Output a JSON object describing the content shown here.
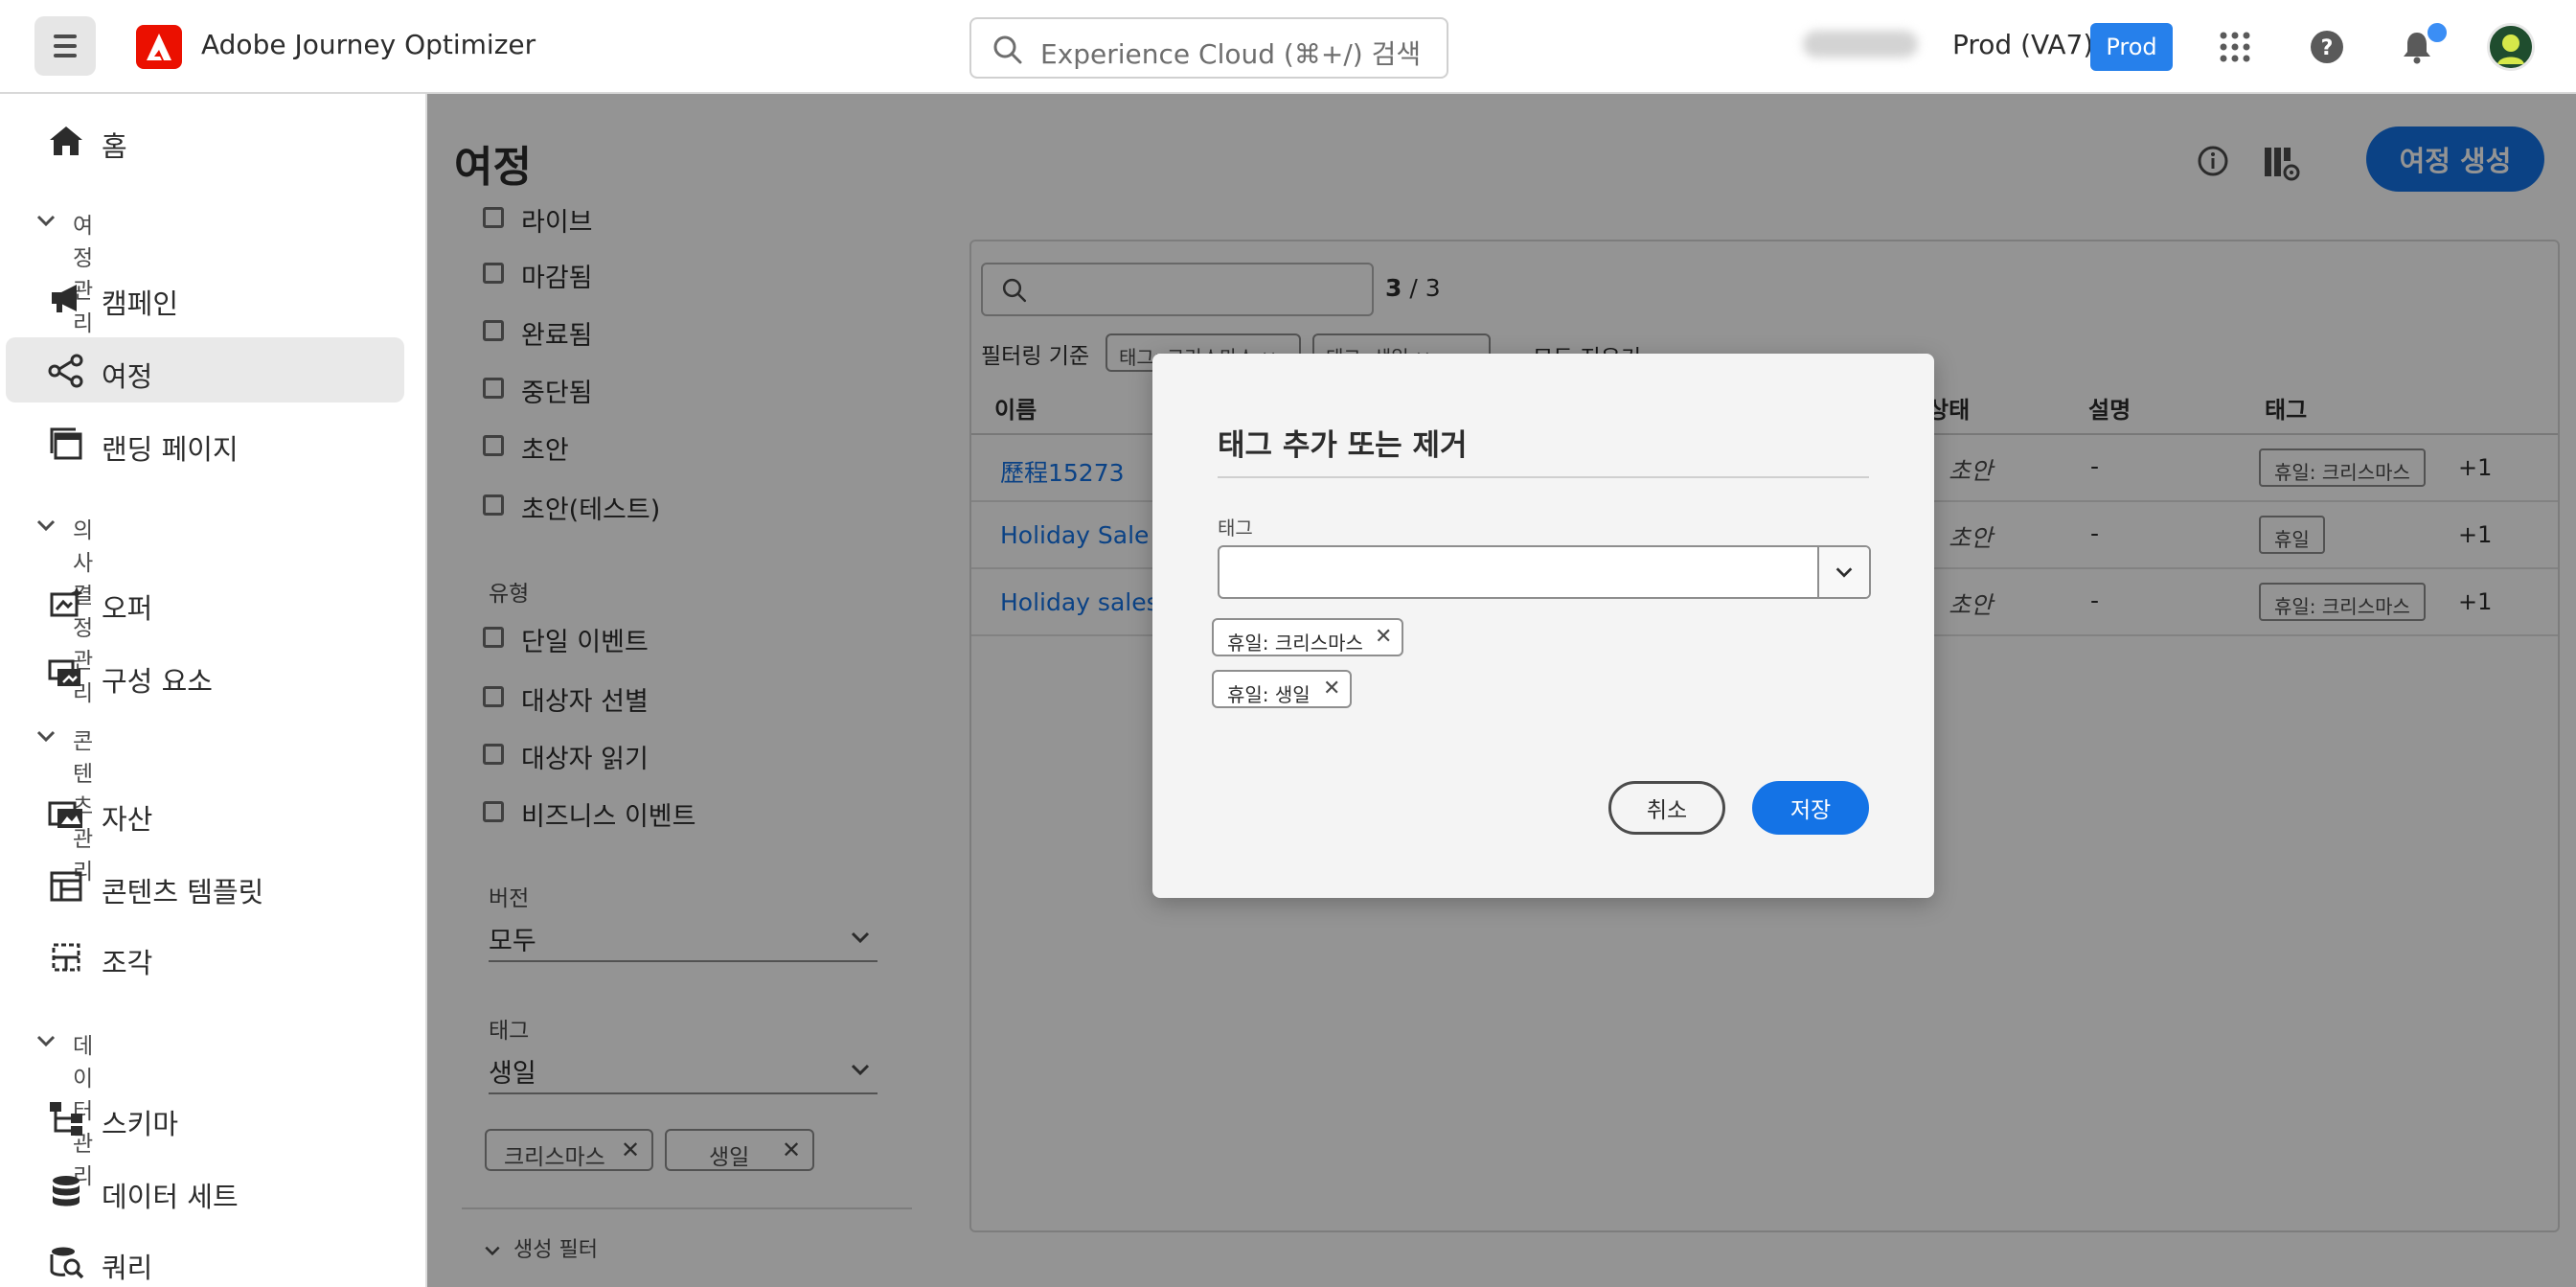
{
  "app": {
    "title": "Adobe Journey Optimizer",
    "search_placeholder": "Experience Cloud (⌘+/) 검색",
    "environment": "Prod (VA7)",
    "env_badge": "Prod"
  },
  "sidebar": {
    "home": "홈",
    "sections": [
      {
        "label": "여정 관리",
        "items": [
          "캠페인",
          "여정",
          "랜딩 페이지"
        ]
      },
      {
        "label": "의사 결정 관리",
        "items": [
          "오퍼",
          "구성 요소"
        ]
      },
      {
        "label": "콘텐츠 관리",
        "items": [
          "자산",
          "콘텐츠 템플릿",
          "조각"
        ]
      },
      {
        "label": "데이터 관리",
        "items": [
          "스키마",
          "데이터 세트",
          "쿼리"
        ]
      }
    ],
    "active_item": "여정"
  },
  "page": {
    "title": "여정",
    "create_button": "여정 생성"
  },
  "filters": {
    "status_items": [
      "라이브",
      "마감됨",
      "완료됨",
      "중단됨",
      "초안",
      "초안(테스트)"
    ],
    "type_heading": "유형",
    "type_items": [
      "단일 이벤트",
      "대상자 선별",
      "대상자 읽기",
      "비즈니스 이벤트"
    ],
    "version_heading": "버전",
    "version_value": "모두",
    "tag_heading": "태그",
    "tag_value": "생일",
    "tag_chips": [
      "크리스마스",
      "생일"
    ],
    "advanced_filter": "생성 필터"
  },
  "list": {
    "count_current": "3",
    "count_total": "/ 3",
    "filter_by": "필터링 기준",
    "active_filters": [
      "태그: 크리스마스 ×",
      "태그: 생일 ×"
    ],
    "clear_all": "모두 지우기",
    "columns": {
      "name": "이름",
      "status": "상태",
      "description": "설명",
      "tags": "태그"
    },
    "rows": [
      {
        "name": "歷程15273",
        "status": "초안",
        "description": "-",
        "tag": "휴일: 크리스마스",
        "more": "+1"
      },
      {
        "name": "Holiday Sale Jo",
        "status": "초안",
        "description": "-",
        "tag": "휴일",
        "more": "+1"
      },
      {
        "name": "Holiday sales jo",
        "status": "초안",
        "description": "-",
        "tag": "휴일: 크리스마스",
        "more": "+1"
      }
    ]
  },
  "dialog": {
    "title": "태그 추가 또는 제거",
    "field_label": "태그",
    "input_value": "",
    "selected_tags": [
      "휴일: 크리스마스",
      "휴일: 생일"
    ],
    "cancel": "취소",
    "save": "저장"
  },
  "colors": {
    "accent": "#1473e6",
    "badge": "#2680eb",
    "adobe_red": "#eb1000",
    "overlay": "rgba(0,0,0,0.42)"
  }
}
